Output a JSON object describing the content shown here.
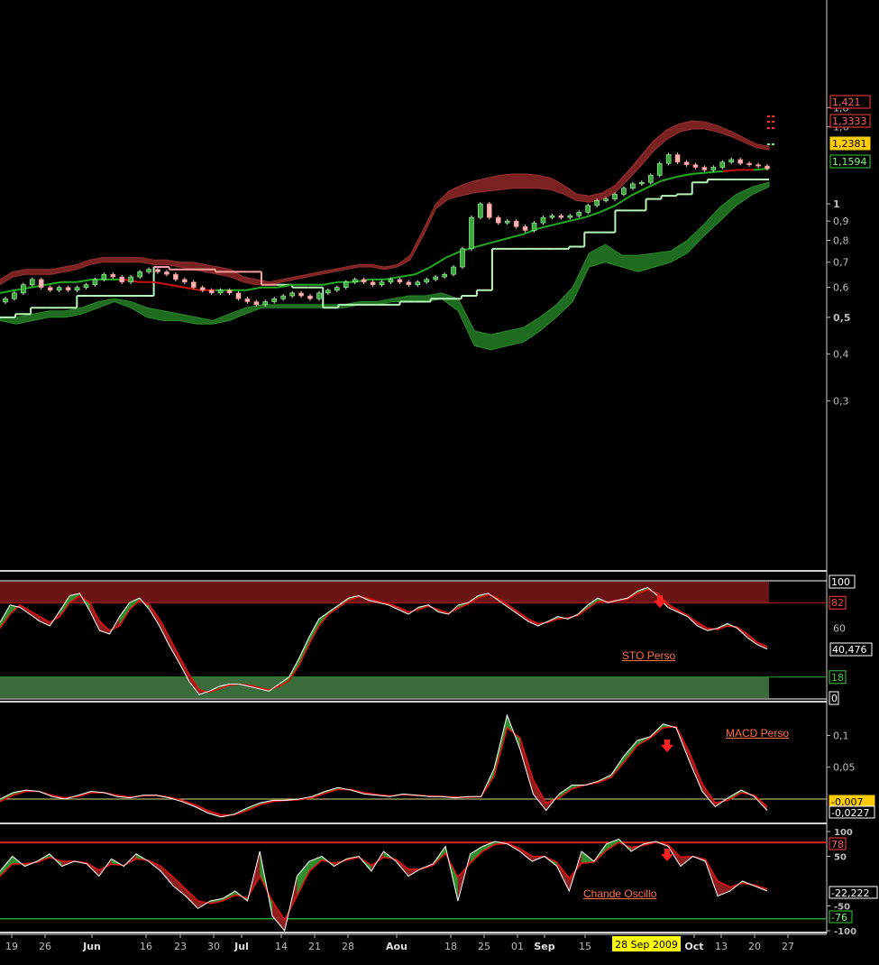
{
  "colors": {
    "background": "#000000",
    "axis": "#bdbdbd",
    "label_orange": "#ff7043",
    "band_red": "#7a2222",
    "band_green": "#1f6b1f",
    "ma_green": "#22aa22",
    "stop_light": "#b8f5b8",
    "stop_pink": "#ff9e9e",
    "highlight_yellow": "#ffff00"
  },
  "x_axis": {
    "ticks": [
      {
        "label": "19",
        "bold": false
      },
      {
        "label": "26",
        "bold": false
      },
      {
        "label": "Jun",
        "bold": true
      },
      {
        "label": "16",
        "bold": false
      },
      {
        "label": "23",
        "bold": false
      },
      {
        "label": "30",
        "bold": false
      },
      {
        "label": "Jul",
        "bold": true
      },
      {
        "label": "14",
        "bold": false
      },
      {
        "label": "21",
        "bold": false
      },
      {
        "label": "28",
        "bold": false
      },
      {
        "label": "Aou",
        "bold": true
      },
      {
        "label": "18",
        "bold": false
      },
      {
        "label": "25",
        "bold": false
      },
      {
        "label": "01",
        "bold": false
      },
      {
        "label": "Sep",
        "bold": true
      },
      {
        "label": "15",
        "bold": false
      },
      {
        "label": "Oct",
        "bold": true
      },
      {
        "label": "13",
        "bold": false
      },
      {
        "label": "20",
        "bold": false
      },
      {
        "label": "27",
        "bold": false
      }
    ],
    "cursor_date": "28 Sep 2009"
  },
  "chart_data": [
    {
      "type": "candlestick",
      "ylim": [
        0.3,
        1.85
      ],
      "scale": "log",
      "y_ticks": [
        "1,8",
        "1,6",
        "1",
        "0,9",
        "0,8",
        "0,7",
        "0,6",
        "0,5",
        "0,4",
        "0,3"
      ],
      "y_ticks_bold": [
        "1",
        "0,5"
      ],
      "price_tags": [
        {
          "label": "1,421",
          "style": "red"
        },
        {
          "label": "1,3333",
          "style": "red"
        },
        {
          "label": "1,2381",
          "style": "yellow"
        },
        {
          "label": "1,1594",
          "style": "green"
        }
      ],
      "close": [
        0.56,
        0.58,
        0.61,
        0.63,
        0.6,
        0.59,
        0.6,
        0.59,
        0.6,
        0.61,
        0.63,
        0.65,
        0.64,
        0.62,
        0.64,
        0.66,
        0.67,
        0.66,
        0.65,
        0.63,
        0.62,
        0.6,
        0.59,
        0.58,
        0.59,
        0.58,
        0.56,
        0.55,
        0.54,
        0.55,
        0.56,
        0.57,
        0.58,
        0.57,
        0.56,
        0.58,
        0.59,
        0.6,
        0.62,
        0.63,
        0.62,
        0.61,
        0.62,
        0.63,
        0.62,
        0.61,
        0.62,
        0.63,
        0.64,
        0.65,
        0.68,
        0.76,
        0.92,
        1.0,
        0.92,
        0.89,
        0.9,
        0.87,
        0.85,
        0.89,
        0.92,
        0.93,
        0.92,
        0.93,
        0.95,
        0.99,
        1.02,
        1.03,
        1.06,
        1.1,
        1.13,
        1.14,
        1.19,
        1.28,
        1.35,
        1.29,
        1.27,
        1.25,
        1.23,
        1.25,
        1.29,
        1.31,
        1.28,
        1.27,
        1.26,
        1.24
      ],
      "upper_band_top": [
        0.63,
        0.66,
        0.67,
        0.67,
        0.67,
        0.68,
        0.69,
        0.71,
        0.72,
        0.72,
        0.72,
        0.72,
        0.71,
        0.71,
        0.7,
        0.7,
        0.69,
        0.68,
        0.67,
        0.64,
        0.63,
        0.62,
        0.63,
        0.64,
        0.65,
        0.66,
        0.67,
        0.68,
        0.69,
        0.69,
        0.68,
        0.69,
        0.73,
        0.85,
        1.0,
        1.08,
        1.12,
        1.15,
        1.17,
        1.19,
        1.2,
        1.2,
        1.19,
        1.17,
        1.12,
        1.06,
        1.05,
        1.07,
        1.12,
        1.22,
        1.34,
        1.47,
        1.57,
        1.63,
        1.66,
        1.65,
        1.61,
        1.56,
        1.5,
        1.44,
        1.42
      ],
      "upper_band_bottom": [
        0.61,
        0.64,
        0.65,
        0.65,
        0.65,
        0.66,
        0.67,
        0.69,
        0.7,
        0.7,
        0.7,
        0.7,
        0.69,
        0.69,
        0.68,
        0.67,
        0.66,
        0.65,
        0.64,
        0.62,
        0.61,
        0.61,
        0.62,
        0.63,
        0.64,
        0.65,
        0.66,
        0.67,
        0.68,
        0.68,
        0.67,
        0.68,
        0.71,
        0.82,
        0.97,
        1.03,
        1.05,
        1.07,
        1.08,
        1.09,
        1.1,
        1.1,
        1.1,
        1.09,
        1.06,
        1.02,
        1.01,
        1.03,
        1.07,
        1.16,
        1.26,
        1.38,
        1.48,
        1.55,
        1.58,
        1.58,
        1.55,
        1.51,
        1.46,
        1.41,
        1.39
      ],
      "lower_band_top": [
        0.5,
        0.5,
        0.51,
        0.52,
        0.52,
        0.53,
        0.55,
        0.56,
        0.55,
        0.53,
        0.52,
        0.51,
        0.5,
        0.49,
        0.51,
        0.53,
        0.54,
        0.54,
        0.54,
        0.54,
        0.54,
        0.54,
        0.55,
        0.55,
        0.56,
        0.57,
        0.57,
        0.58,
        0.56,
        0.46,
        0.45,
        0.46,
        0.47,
        0.5,
        0.54,
        0.6,
        0.74,
        0.78,
        0.73,
        0.73,
        0.74,
        0.75,
        0.8,
        0.88,
        0.98,
        1.06,
        1.11,
        1.14
      ],
      "lower_band_bottom": [
        0.49,
        0.48,
        0.49,
        0.5,
        0.5,
        0.51,
        0.53,
        0.55,
        0.53,
        0.5,
        0.49,
        0.49,
        0.48,
        0.48,
        0.49,
        0.51,
        0.53,
        0.53,
        0.53,
        0.53,
        0.53,
        0.53,
        0.54,
        0.54,
        0.55,
        0.55,
        0.55,
        0.56,
        0.52,
        0.42,
        0.41,
        0.42,
        0.43,
        0.46,
        0.5,
        0.55,
        0.68,
        0.7,
        0.68,
        0.66,
        0.68,
        0.7,
        0.74,
        0.82,
        0.9,
        0.99,
        1.06,
        1.11
      ],
      "ma": [
        0.58,
        0.59,
        0.6,
        0.61,
        0.62,
        0.62,
        0.63,
        0.63,
        0.63,
        0.62,
        0.62,
        0.61,
        0.6,
        0.59,
        0.59,
        0.59,
        0.59,
        0.6,
        0.6,
        0.61,
        0.61,
        0.61,
        0.62,
        0.62,
        0.63,
        0.63,
        0.64,
        0.65,
        0.68,
        0.72,
        0.75,
        0.77,
        0.79,
        0.81,
        0.83,
        0.86,
        0.88,
        0.9,
        0.92,
        0.95,
        0.99,
        1.05,
        1.1,
        1.15,
        1.18,
        1.2,
        1.21,
        1.22,
        1.23,
        1.23,
        1.24
      ],
      "ma_trend_up": [
        true,
        true,
        true,
        true,
        true,
        true,
        true,
        true,
        false,
        false,
        false,
        false,
        false,
        false,
        true,
        true,
        true,
        true,
        true,
        true,
        true,
        true,
        true,
        true,
        true,
        true,
        true,
        true,
        true,
        true,
        true,
        true,
        true,
        true,
        true,
        true,
        true,
        true,
        true,
        true,
        true,
        true,
        true,
        true,
        true,
        true,
        true,
        false,
        false,
        true,
        true
      ],
      "stop_line": [
        0.5,
        0.51,
        0.53,
        0.53,
        0.53,
        0.57,
        0.57,
        0.57,
        0.57,
        0.57,
        0.68,
        0.67,
        0.67,
        0.67,
        0.66,
        0.66,
        0.66,
        0.61,
        0.61,
        0.6,
        0.6,
        0.53,
        0.54,
        0.54,
        0.54,
        0.54,
        0.55,
        0.55,
        0.56,
        0.56,
        0.57,
        0.59,
        0.76,
        0.76,
        0.76,
        0.76,
        0.76,
        0.77,
        0.84,
        0.84,
        0.96,
        0.96,
        1.03,
        1.05,
        1.06,
        1.14,
        1.16,
        1.16,
        1.16,
        1.16,
        1.16
      ],
      "stop_side_up": [
        true,
        true,
        true,
        true,
        true,
        true,
        true,
        true,
        true,
        true,
        false,
        false,
        false,
        false,
        false,
        false,
        false,
        false,
        true,
        true,
        true,
        true,
        true,
        true,
        true,
        true,
        true,
        true,
        true,
        true,
        true,
        true,
        true,
        true,
        true,
        true,
        true,
        true,
        true,
        true,
        true,
        true,
        true,
        true,
        true,
        true,
        true,
        true,
        true,
        true,
        true
      ]
    },
    {
      "type": "line",
      "name": "STO Perso",
      "ylim": [
        0,
        100
      ],
      "y_ticks": [
        "100",
        "82",
        "60",
        "18",
        "0"
      ],
      "levels": {
        "overbought": 82,
        "oversold": 18
      },
      "price_tags": [
        {
          "label": "40,476",
          "style": "white"
        }
      ],
      "k": [
        65,
        80,
        78,
        72,
        66,
        62,
        75,
        88,
        90,
        75,
        58,
        55,
        70,
        82,
        86,
        76,
        62,
        45,
        30,
        14,
        3,
        6,
        10,
        12,
        12,
        10,
        8,
        6,
        12,
        18,
        34,
        52,
        68,
        74,
        80,
        86,
        88,
        84,
        82,
        80,
        76,
        72,
        78,
        80,
        74,
        72,
        80,
        82,
        88,
        90,
        84,
        78,
        72,
        66,
        62,
        66,
        70,
        68,
        72,
        80,
        86,
        82,
        84,
        86,
        92,
        95,
        88,
        78,
        74,
        70,
        62,
        58,
        60,
        64,
        60,
        52,
        46,
        42
      ],
      "d": [
        60,
        72,
        80,
        75,
        70,
        65,
        70,
        82,
        88,
        82,
        66,
        58,
        62,
        76,
        84,
        80,
        68,
        52,
        36,
        20,
        7,
        5,
        8,
        11,
        12,
        11,
        9,
        7,
        10,
        15,
        28,
        46,
        62,
        72,
        78,
        84,
        87,
        86,
        83,
        81,
        78,
        74,
        76,
        79,
        76,
        73,
        77,
        81,
        86,
        89,
        86,
        80,
        74,
        68,
        64,
        65,
        68,
        69,
        71,
        77,
        83,
        83,
        84,
        85,
        90,
        93,
        90,
        81,
        76,
        71,
        65,
        60,
        59,
        62,
        61,
        55,
        48,
        44
      ]
    },
    {
      "type": "line",
      "name": "MACD Perso",
      "ylim": [
        -0.04,
        0.16
      ],
      "y_ticks": [
        "0,1",
        "0,05"
      ],
      "price_tags": [
        {
          "label": "-0,007",
          "style": "yellow"
        },
        {
          "label": "-0,0227",
          "style": "white"
        }
      ],
      "macd": [
        0,
        0.01,
        0.014,
        0.012,
        0.004,
        0,
        0.006,
        0.012,
        0.01,
        0.004,
        0.002,
        0.006,
        0.006,
        0.002,
        -0.004,
        -0.012,
        -0.022,
        -0.028,
        -0.024,
        -0.014,
        -0.006,
        -0.002,
        -0.002,
        0,
        0.004,
        0.012,
        0.018,
        0.014,
        0.008,
        0.006,
        0.004,
        0.008,
        0.006,
        0.004,
        0.004,
        0.002,
        0.004,
        0.004,
        0.048,
        0.132,
        0.078,
        0.008,
        -0.018,
        0.008,
        0.022,
        0.022,
        0.028,
        0.038,
        0.068,
        0.092,
        0.098,
        0.118,
        0.112,
        0.06,
        0.012,
        -0.012,
        0.002,
        0.014,
        0.004,
        -0.018
      ],
      "signal": [
        -0.004,
        0.006,
        0.012,
        0.012,
        0.006,
        0.002,
        0.004,
        0.01,
        0.01,
        0.006,
        0.003,
        0.005,
        0.006,
        0.003,
        -0.002,
        -0.009,
        -0.018,
        -0.025,
        -0.025,
        -0.018,
        -0.009,
        -0.004,
        -0.002,
        -0.001,
        0.002,
        0.009,
        0.015,
        0.015,
        0.01,
        0.007,
        0.005,
        0.007,
        0.006,
        0.005,
        0.004,
        0.003,
        0.003,
        0.004,
        0.036,
        0.112,
        0.096,
        0.03,
        -0.006,
        0.002,
        0.016,
        0.022,
        0.026,
        0.034,
        0.058,
        0.084,
        0.096,
        0.112,
        0.114,
        0.074,
        0.024,
        -0.006,
        -0.002,
        0.01,
        0.006,
        -0.012
      ]
    },
    {
      "type": "line",
      "name": "Chande Oscillo",
      "ylim": [
        -100,
        100
      ],
      "y_ticks": [
        "100",
        "50",
        "-50",
        "-100"
      ],
      "levels": {
        "upper": 78,
        "lower": -76
      },
      "price_tags": [
        {
          "label": "78",
          "style": "red"
        },
        {
          "label": "-22,222",
          "style": "white"
        },
        {
          "label": "-76",
          "style": "green"
        }
      ],
      "cmo": [
        20,
        50,
        30,
        40,
        55,
        30,
        40,
        35,
        10,
        45,
        30,
        55,
        40,
        20,
        -10,
        -30,
        -55,
        -40,
        -35,
        -20,
        -40,
        60,
        -70,
        -100,
        10,
        40,
        50,
        30,
        45,
        50,
        20,
        60,
        40,
        10,
        25,
        35,
        70,
        -40,
        55,
        70,
        80,
        75,
        60,
        40,
        50,
        30,
        -20,
        60,
        40,
        75,
        85,
        60,
        75,
        80,
        70,
        30,
        50,
        40,
        -30,
        -20,
        0,
        -10,
        -20
      ],
      "signal": [
        10,
        35,
        35,
        38,
        48,
        40,
        40,
        37,
        22,
        34,
        32,
        45,
        42,
        30,
        8,
        -16,
        -40,
        -45,
        -40,
        -28,
        -34,
        10,
        -40,
        -78,
        -30,
        20,
        42,
        36,
        42,
        48,
        32,
        48,
        44,
        24,
        24,
        32,
        56,
        8,
        36,
        60,
        74,
        76,
        66,
        50,
        50,
        38,
        6,
        36,
        38,
        62,
        78,
        68,
        72,
        78,
        73,
        48,
        50,
        44,
        0,
        -12,
        -4,
        -8,
        -16
      ]
    }
  ]
}
